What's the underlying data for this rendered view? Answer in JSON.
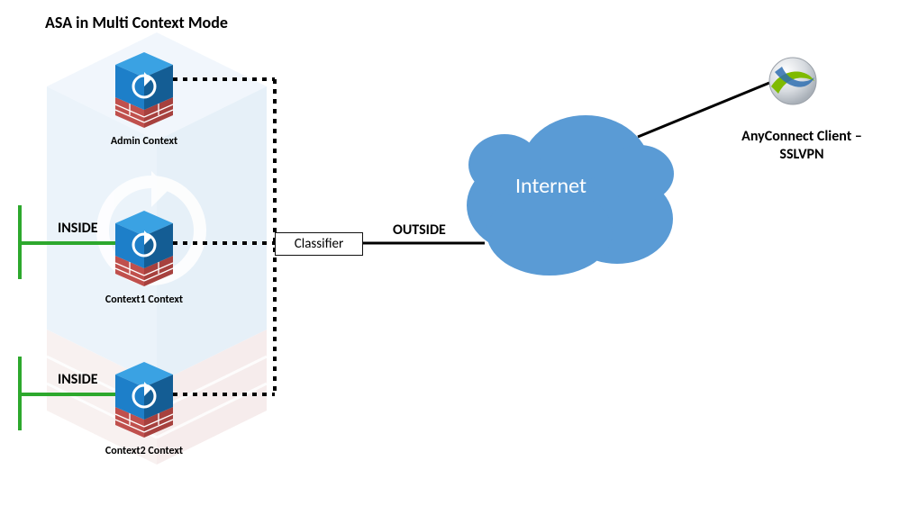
{
  "title": "ASA in Multi Context Mode",
  "contexts": [
    {
      "label": "Admin Context"
    },
    {
      "label": "Context1 Context"
    },
    {
      "label": "Context2 Context"
    }
  ],
  "classifier": {
    "label": "Classifier"
  },
  "zones": {
    "inside": "INSIDE",
    "outside": "OUTSIDE"
  },
  "cloud": {
    "label": "Internet"
  },
  "anyconnect": {
    "label_line1": "AnyConnect Client –",
    "label_line2": "SSLVPN"
  },
  "colors": {
    "inside_line": "#2da82d",
    "dotted": "#000000",
    "cloud": "#5a9bd5",
    "brick": "#c0504d",
    "cube_top": "#3aa2e3",
    "cube_front": "#1d7fc9",
    "cube_side": "#145d94",
    "ac_accent": "#7fba00"
  }
}
